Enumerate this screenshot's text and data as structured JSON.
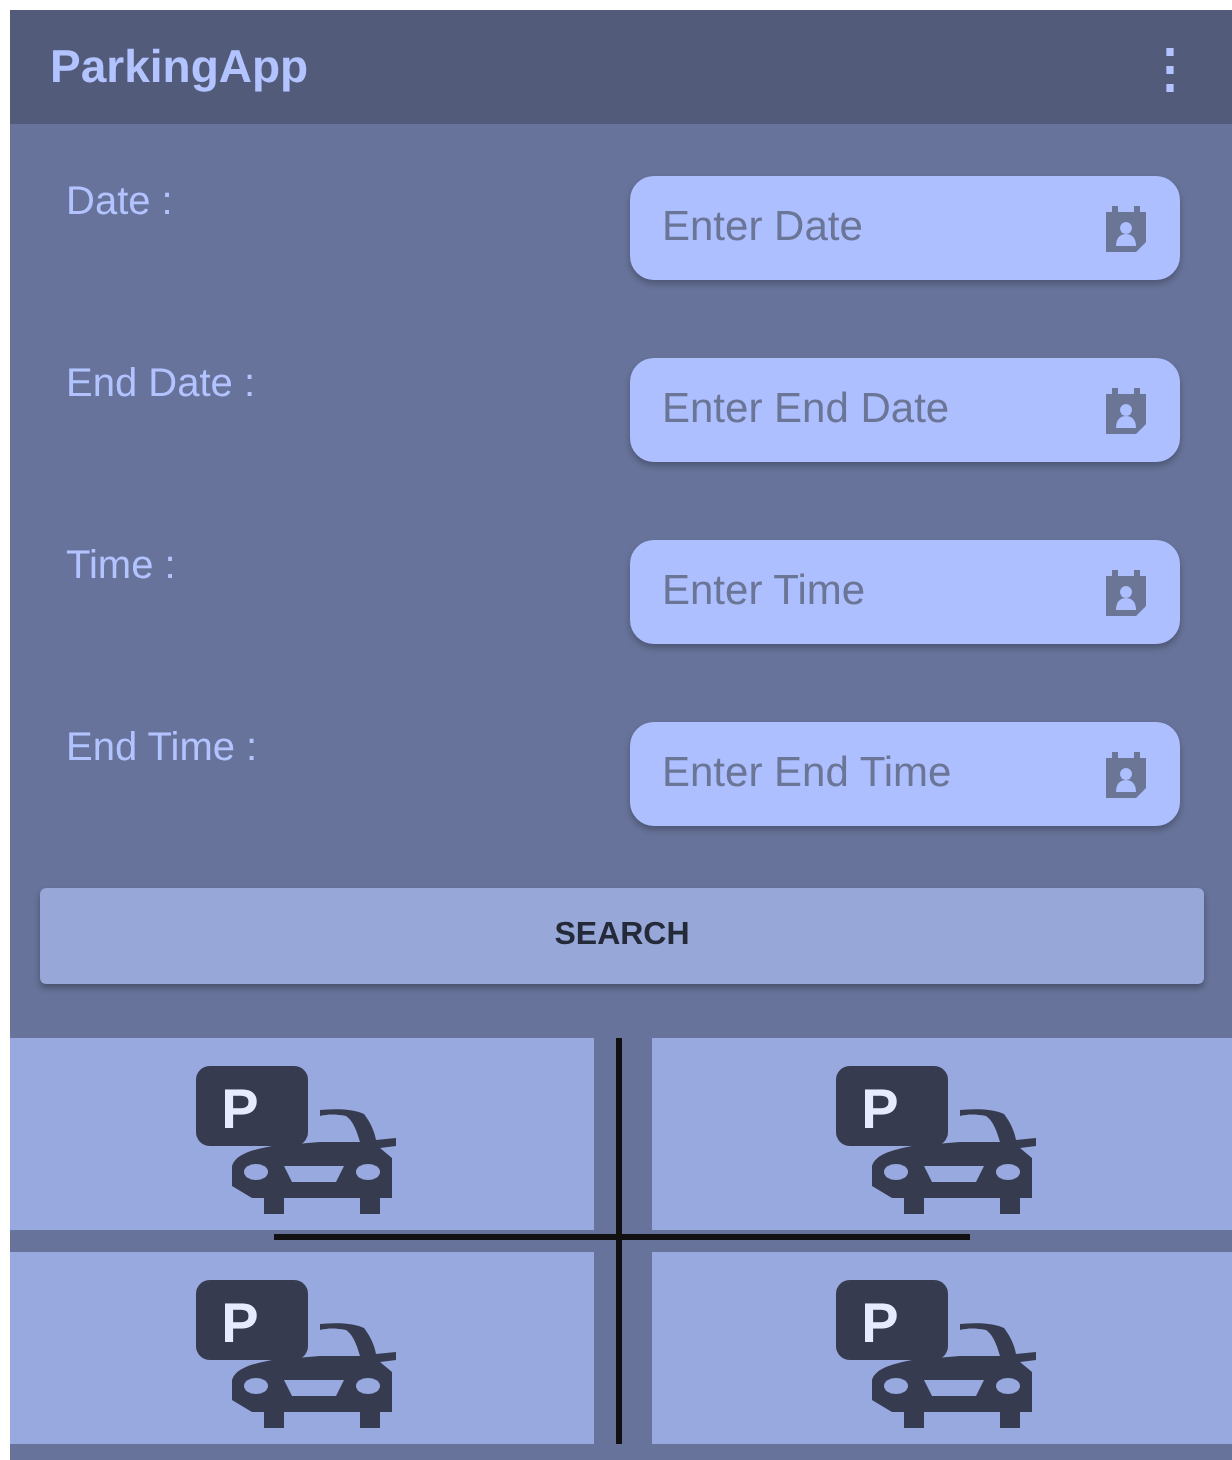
{
  "app_bar": {
    "title": "ParkingApp",
    "menu_icon": "⋮"
  },
  "form": [
    {
      "label": "Date :",
      "placeholder": "Enter Date"
    },
    {
      "label": "End Date :",
      "placeholder": "Enter End Date"
    },
    {
      "label": "Time :",
      "placeholder": "Enter Time"
    },
    {
      "label": "End Time :",
      "placeholder": "Enter End Time"
    }
  ],
  "search_button": "SEARCH",
  "tiles": [
    {
      "sign": "P"
    },
    {
      "sign": "P"
    },
    {
      "sign": "P"
    },
    {
      "sign": "P"
    }
  ]
}
